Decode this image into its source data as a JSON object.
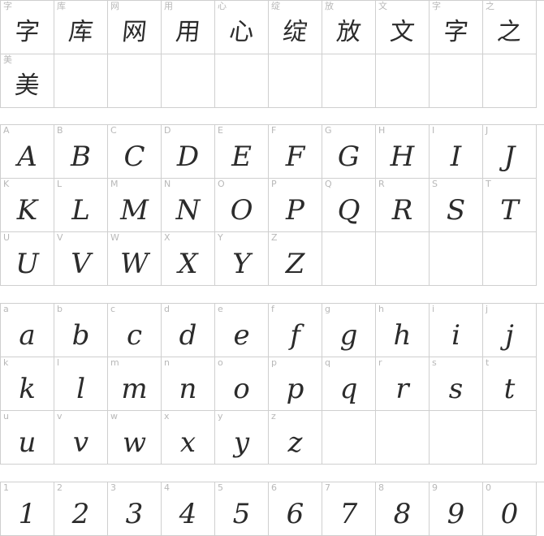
{
  "sections": [
    {
      "id": "chinese",
      "rows": [
        [
          {
            "label": "字",
            "glyph": "字",
            "cjk": true
          },
          {
            "label": "库",
            "glyph": "库",
            "cjk": true
          },
          {
            "label": "网",
            "glyph": "网",
            "cjk": true
          },
          {
            "label": "用",
            "glyph": "用",
            "cjk": true
          },
          {
            "label": "心",
            "glyph": "心",
            "cjk": true
          },
          {
            "label": "绽",
            "glyph": "绽",
            "cjk": true
          },
          {
            "label": "放",
            "glyph": "放",
            "cjk": true
          },
          {
            "label": "文",
            "glyph": "文",
            "cjk": true
          },
          {
            "label": "字",
            "glyph": "字",
            "cjk": true
          },
          {
            "label": "之",
            "glyph": "之",
            "cjk": true
          }
        ],
        [
          {
            "label": "美",
            "glyph": "美",
            "cjk": true
          }
        ]
      ]
    },
    {
      "id": "uppercase",
      "rows": [
        [
          {
            "label": "A",
            "glyph": "A"
          },
          {
            "label": "B",
            "glyph": "B"
          },
          {
            "label": "C",
            "glyph": "C"
          },
          {
            "label": "D",
            "glyph": "D"
          },
          {
            "label": "E",
            "glyph": "E"
          },
          {
            "label": "F",
            "glyph": "F"
          },
          {
            "label": "G",
            "glyph": "G"
          },
          {
            "label": "H",
            "glyph": "H"
          },
          {
            "label": "I",
            "glyph": "I"
          },
          {
            "label": "J",
            "glyph": "J"
          }
        ],
        [
          {
            "label": "K",
            "glyph": "K"
          },
          {
            "label": "L",
            "glyph": "L"
          },
          {
            "label": "M",
            "glyph": "M"
          },
          {
            "label": "N",
            "glyph": "N"
          },
          {
            "label": "O",
            "glyph": "O"
          },
          {
            "label": "P",
            "glyph": "P"
          },
          {
            "label": "Q",
            "glyph": "Q"
          },
          {
            "label": "R",
            "glyph": "R"
          },
          {
            "label": "S",
            "glyph": "S"
          },
          {
            "label": "T",
            "glyph": "T"
          }
        ],
        [
          {
            "label": "U",
            "glyph": "U"
          },
          {
            "label": "V",
            "glyph": "V"
          },
          {
            "label": "W",
            "glyph": "W"
          },
          {
            "label": "X",
            "glyph": "X"
          },
          {
            "label": "Y",
            "glyph": "Y"
          },
          {
            "label": "Z",
            "glyph": "Z"
          }
        ]
      ]
    },
    {
      "id": "lowercase",
      "rows": [
        [
          {
            "label": "a",
            "glyph": "a"
          },
          {
            "label": "b",
            "glyph": "b"
          },
          {
            "label": "c",
            "glyph": "c"
          },
          {
            "label": "d",
            "glyph": "d"
          },
          {
            "label": "e",
            "glyph": "e"
          },
          {
            "label": "f",
            "glyph": "f"
          },
          {
            "label": "g",
            "glyph": "g"
          },
          {
            "label": "h",
            "glyph": "h"
          },
          {
            "label": "i",
            "glyph": "i"
          },
          {
            "label": "j",
            "glyph": "j"
          }
        ],
        [
          {
            "label": "k",
            "glyph": "k"
          },
          {
            "label": "l",
            "glyph": "l"
          },
          {
            "label": "m",
            "glyph": "m"
          },
          {
            "label": "n",
            "glyph": "n"
          },
          {
            "label": "o",
            "glyph": "o"
          },
          {
            "label": "p",
            "glyph": "p"
          },
          {
            "label": "q",
            "glyph": "q"
          },
          {
            "label": "r",
            "glyph": "r"
          },
          {
            "label": "s",
            "glyph": "s"
          },
          {
            "label": "t",
            "glyph": "t"
          }
        ],
        [
          {
            "label": "u",
            "glyph": "u"
          },
          {
            "label": "v",
            "glyph": "v"
          },
          {
            "label": "w",
            "glyph": "w"
          },
          {
            "label": "x",
            "glyph": "x"
          },
          {
            "label": "y",
            "glyph": "y"
          },
          {
            "label": "z",
            "glyph": "z"
          }
        ]
      ]
    },
    {
      "id": "digits",
      "rows": [
        [
          {
            "label": "1",
            "glyph": "1"
          },
          {
            "label": "2",
            "glyph": "2"
          },
          {
            "label": "3",
            "glyph": "3"
          },
          {
            "label": "4",
            "glyph": "4"
          },
          {
            "label": "5",
            "glyph": "5"
          },
          {
            "label": "6",
            "glyph": "6"
          },
          {
            "label": "7",
            "glyph": "7"
          },
          {
            "label": "8",
            "glyph": "8"
          },
          {
            "label": "9",
            "glyph": "9"
          },
          {
            "label": "0",
            "glyph": "0"
          }
        ]
      ]
    }
  ]
}
